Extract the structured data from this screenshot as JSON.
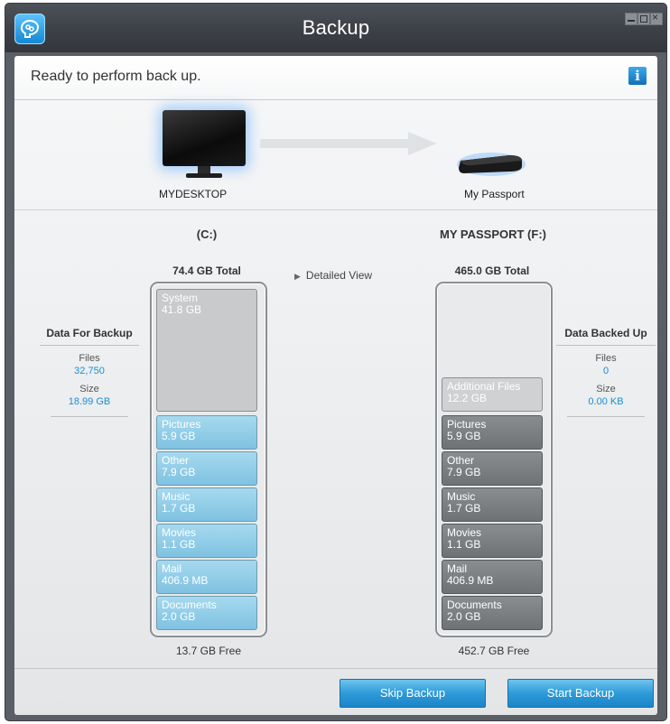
{
  "window": {
    "title": "Backup"
  },
  "status": {
    "text": "Ready to perform back up.",
    "info_icon": "info-icon"
  },
  "source": {
    "device_label": "MYDESKTOP",
    "volume": "(C:)",
    "total": "74.4 GB Total",
    "free": "13.7 GB Free",
    "system": {
      "label": "System",
      "size": "41.8 GB"
    },
    "segments": [
      {
        "label": "Pictures",
        "size": "5.9 GB"
      },
      {
        "label": "Other",
        "size": "7.9 GB"
      },
      {
        "label": "Music",
        "size": "1.7 GB"
      },
      {
        "label": "Movies",
        "size": "1.1 GB"
      },
      {
        "label": "Mail",
        "size": "406.9 MB"
      },
      {
        "label": "Documents",
        "size": "2.0 GB"
      }
    ]
  },
  "destination": {
    "device_label": "My Passport",
    "volume": "MY PASSPORT (F:)",
    "total": "465.0 GB Total",
    "free": "452.7 GB Free",
    "additional": {
      "label": "Additional Files",
      "size": "12.2 GB"
    },
    "segments": [
      {
        "label": "Pictures",
        "size": "5.9 GB"
      },
      {
        "label": "Other",
        "size": "7.9 GB"
      },
      {
        "label": "Music",
        "size": "1.7 GB"
      },
      {
        "label": "Movies",
        "size": "1.1 GB"
      },
      {
        "label": "Mail",
        "size": "406.9 MB"
      },
      {
        "label": "Documents",
        "size": "2.0 GB"
      }
    ]
  },
  "detailed_view": {
    "label": "Detailed View"
  },
  "data_for_backup": {
    "heading": "Data For Backup",
    "files_label": "Files",
    "files_value": "32,750",
    "size_label": "Size",
    "size_value": "18.99 GB"
  },
  "data_backed_up": {
    "heading": "Data Backed Up",
    "files_label": "Files",
    "files_value": "0",
    "size_label": "Size",
    "size_value": "0.00 KB"
  },
  "buttons": {
    "skip": "Skip Backup",
    "start": "Start Backup"
  },
  "colors": {
    "accent": "#1c84c8",
    "value_text": "#1a8fd1",
    "source_segment": "#8cc9e6",
    "dest_segment": "#7a7d80"
  }
}
